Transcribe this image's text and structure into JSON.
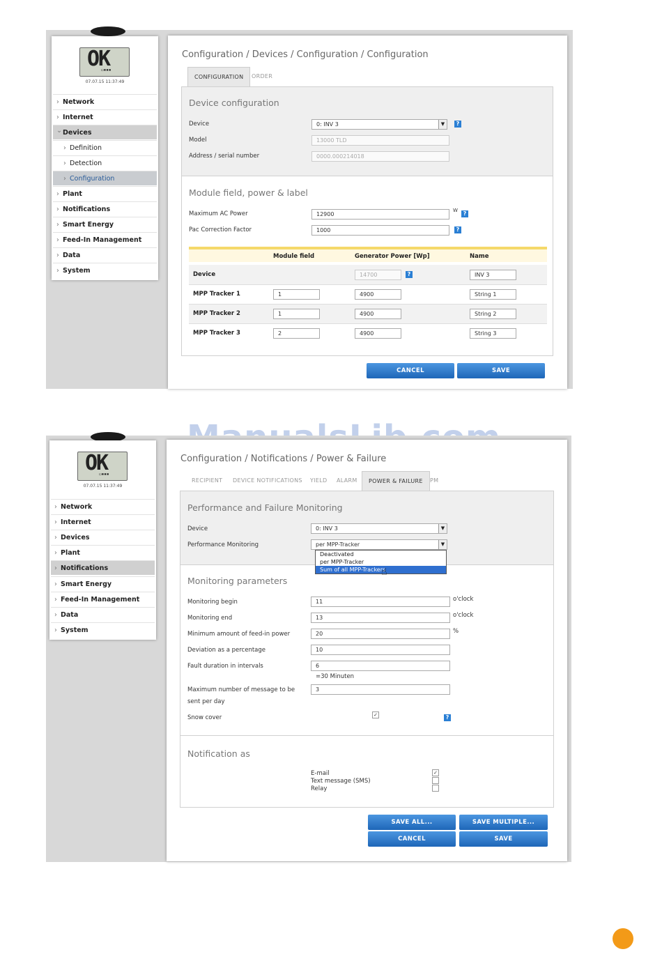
{
  "watermark": "ManualsLib.com",
  "lcd": {
    "text": "OK",
    "datetime": "07.07.15 11:37:49"
  },
  "screen1": {
    "nav": [
      {
        "label": "Network"
      },
      {
        "label": "Internet"
      },
      {
        "label": "Devices"
      },
      {
        "label": "Definition"
      },
      {
        "label": "Detection"
      },
      {
        "label": "Configuration"
      },
      {
        "label": "Plant"
      },
      {
        "label": "Notifications"
      },
      {
        "label": "Smart Energy"
      },
      {
        "label": "Feed-In Management"
      },
      {
        "label": "Data"
      },
      {
        "label": "System"
      }
    ],
    "breadcrumb": "Configuration / Devices / Configuration / Configuration",
    "tabs": [
      "CONFIGURATION",
      "ORDER"
    ],
    "device_config": {
      "title": "Device configuration",
      "device_label": "Device",
      "device_value": "0: INV 3",
      "model_label": "Model",
      "model_value": "13000 TLD",
      "address_label": "Address / serial number",
      "address_value": "0000.000214018"
    },
    "module_field": {
      "title": "Module field, power & label",
      "max_ac_label": "Maximum AC Power",
      "max_ac_value": "12900",
      "max_ac_unit": "W",
      "pac_label": "Pac Correction Factor",
      "pac_value": "1000"
    },
    "table": {
      "headers": [
        "Module field",
        "Generator Power [Wp]",
        "Name"
      ],
      "rows": [
        {
          "label": "Device",
          "module": "",
          "power": "14700",
          "name": "INV 3"
        },
        {
          "label": "MPP Tracker 1",
          "module": "1",
          "power": "4900",
          "name": "String 1"
        },
        {
          "label": "MPP Tracker 2",
          "module": "1",
          "power": "4900",
          "name": "String 2"
        },
        {
          "label": "MPP Tracker 3",
          "module": "2",
          "power": "4900",
          "name": "String 3"
        }
      ]
    },
    "buttons": {
      "cancel": "CANCEL",
      "save": "SAVE"
    }
  },
  "screen2": {
    "nav": [
      {
        "label": "Network"
      },
      {
        "label": "Internet"
      },
      {
        "label": "Devices"
      },
      {
        "label": "Plant"
      },
      {
        "label": "Notifications"
      },
      {
        "label": "Smart Energy"
      },
      {
        "label": "Feed-In Management"
      },
      {
        "label": "Data"
      },
      {
        "label": "System"
      }
    ],
    "breadcrumb": "Configuration / Notifications / Power & Failure",
    "tabs": [
      "RECIPIENT",
      "DEVICE NOTIFICATIONS",
      "YIELD",
      "ALARM",
      "POWER & FAILURE",
      "PM"
    ],
    "perf": {
      "title": "Performance and Failure Monitoring",
      "device_label": "Device",
      "device_value": "0: INV 3",
      "pm_label": "Performance Monitoring",
      "pm_value": "per MPP-Tracker",
      "options": [
        "Deactivated",
        "per MPP-Tracker",
        "Sum of all MPP-Trackers"
      ]
    },
    "params": {
      "title": "Monitoring parameters",
      "begin_label": "Monitoring begin",
      "begin_value": "11",
      "begin_unit": "o'clock",
      "end_label": "Monitoring end",
      "end_value": "13",
      "end_unit": "o'clock",
      "min_label": "Minimum amount of feed-in power",
      "min_value": "20",
      "min_unit": "%",
      "dev_label": "Deviation as a percentage",
      "dev_value": "10",
      "fault_label": "Fault duration in intervals",
      "fault_value": "6",
      "fault_note": "=30 Minuten",
      "max_msg_label_1": "Maximum number of message to be",
      "max_msg_label_2": "sent per day",
      "max_msg_value": "3",
      "snow_label": "Snow cover"
    },
    "notify": {
      "title": "Notification as",
      "email": "E-mail",
      "sms": "Text message (SMS)",
      "relay": "Relay"
    },
    "buttons": {
      "save_all": "SAVE ALL...",
      "save_multiple": "SAVE MULTIPLE...",
      "cancel": "CANCEL",
      "save": "SAVE"
    }
  }
}
